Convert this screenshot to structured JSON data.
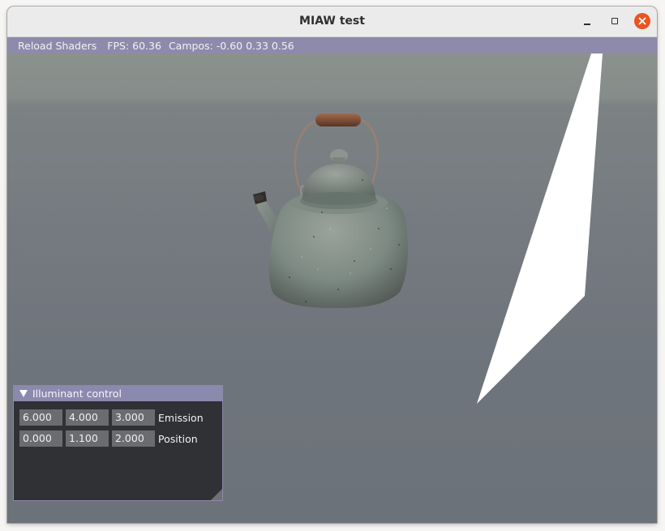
{
  "window": {
    "title": "MIAW test"
  },
  "menubar": {
    "reload_label": "Reload Shaders",
    "fps_label": "FPS: 60.36",
    "campos_label": "Campos: -0.60 0.33 0.56"
  },
  "illuminant_panel": {
    "title": "Illuminant control",
    "rows": [
      {
        "label": "Emission",
        "values": [
          "6.000",
          "4.000",
          "3.000"
        ]
      },
      {
        "label": "Position",
        "values": [
          "0.000",
          "1.100",
          "2.000"
        ]
      }
    ]
  },
  "colors": {
    "accent": "#8b89ae",
    "close_button": "#e95420",
    "panel_background": "#2f3134"
  }
}
